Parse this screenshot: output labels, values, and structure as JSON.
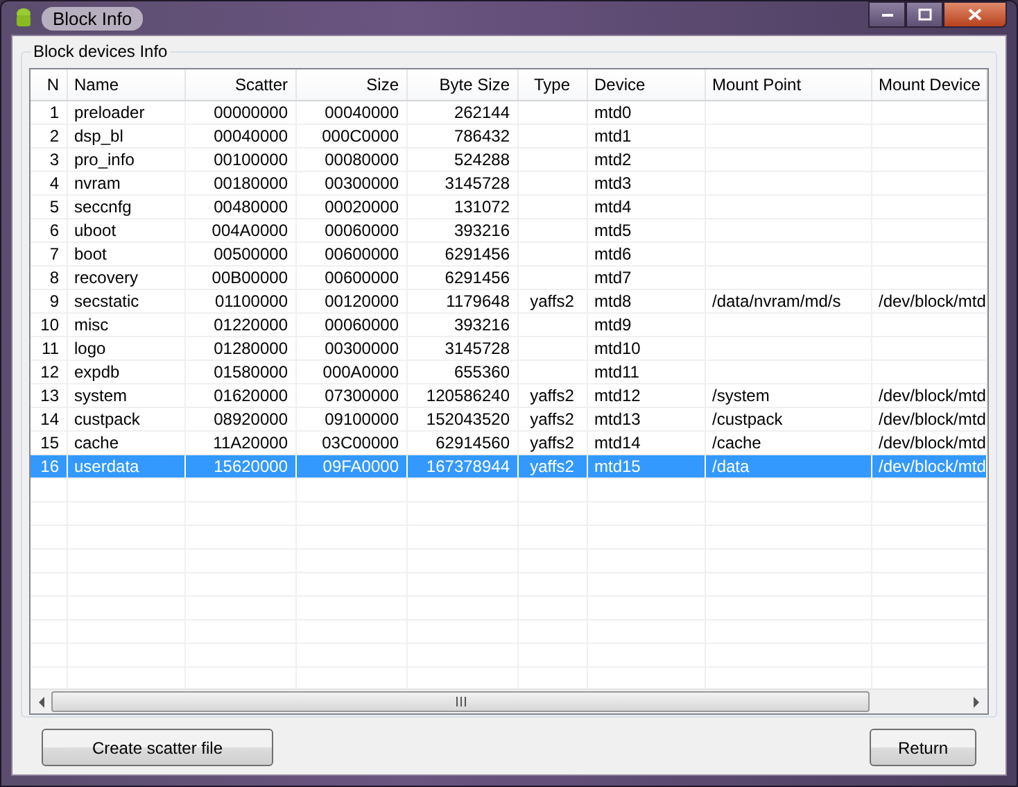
{
  "window": {
    "title": "Block Info"
  },
  "group": {
    "title": "Block devices Info"
  },
  "table": {
    "columns": [
      {
        "label": "N"
      },
      {
        "label": "Name"
      },
      {
        "label": "Scatter"
      },
      {
        "label": "Size"
      },
      {
        "label": "Byte Size"
      },
      {
        "label": "Type"
      },
      {
        "label": "Device"
      },
      {
        "label": "Mount Point"
      },
      {
        "label": "Mount Device"
      }
    ],
    "rows": [
      {
        "cells": [
          "1",
          "preloader",
          "00000000",
          "00040000",
          "262144",
          "",
          "mtd0",
          "",
          ""
        ],
        "selected": false
      },
      {
        "cells": [
          "2",
          "dsp_bl",
          "00040000",
          "000C0000",
          "786432",
          "",
          "mtd1",
          "",
          ""
        ],
        "selected": false
      },
      {
        "cells": [
          "3",
          "pro_info",
          "00100000",
          "00080000",
          "524288",
          "",
          "mtd2",
          "",
          ""
        ],
        "selected": false
      },
      {
        "cells": [
          "4",
          "nvram",
          "00180000",
          "00300000",
          "3145728",
          "",
          "mtd3",
          "",
          ""
        ],
        "selected": false
      },
      {
        "cells": [
          "5",
          "seccnfg",
          "00480000",
          "00020000",
          "131072",
          "",
          "mtd4",
          "",
          ""
        ],
        "selected": false
      },
      {
        "cells": [
          "6",
          "uboot",
          "004A0000",
          "00060000",
          "393216",
          "",
          "mtd5",
          "",
          ""
        ],
        "selected": false
      },
      {
        "cells": [
          "7",
          "boot",
          "00500000",
          "00600000",
          "6291456",
          "",
          "mtd6",
          "",
          ""
        ],
        "selected": false
      },
      {
        "cells": [
          "8",
          "recovery",
          "00B00000",
          "00600000",
          "6291456",
          "",
          "mtd7",
          "",
          ""
        ],
        "selected": false
      },
      {
        "cells": [
          "9",
          "secstatic",
          "01100000",
          "00120000",
          "1179648",
          "yaffs2",
          "mtd8",
          "/data/nvram/md/s",
          "/dev/block/mtd"
        ],
        "selected": false
      },
      {
        "cells": [
          "10",
          "misc",
          "01220000",
          "00060000",
          "393216",
          "",
          "mtd9",
          "",
          ""
        ],
        "selected": false
      },
      {
        "cells": [
          "11",
          "logo",
          "01280000",
          "00300000",
          "3145728",
          "",
          "mtd10",
          "",
          ""
        ],
        "selected": false
      },
      {
        "cells": [
          "12",
          "expdb",
          "01580000",
          "000A0000",
          "655360",
          "",
          "mtd11",
          "",
          ""
        ],
        "selected": false
      },
      {
        "cells": [
          "13",
          "system",
          "01620000",
          "07300000",
          "120586240",
          "yaffs2",
          "mtd12",
          "/system",
          "/dev/block/mtd"
        ],
        "selected": false
      },
      {
        "cells": [
          "14",
          "custpack",
          "08920000",
          "09100000",
          "152043520",
          "yaffs2",
          "mtd13",
          "/custpack",
          "/dev/block/mtd"
        ],
        "selected": false
      },
      {
        "cells": [
          "15",
          "cache",
          "11A20000",
          "03C00000",
          "62914560",
          "yaffs2",
          "mtd14",
          "/cache",
          "/dev/block/mtd"
        ],
        "selected": false
      },
      {
        "cells": [
          "16",
          "userdata",
          "15620000",
          "09FA0000",
          "167378944",
          "yaffs2",
          "mtd15",
          "/data",
          "/dev/block/mtd"
        ],
        "selected": true
      }
    ]
  },
  "buttons": {
    "create": "Create scatter file",
    "return": "Return"
  }
}
